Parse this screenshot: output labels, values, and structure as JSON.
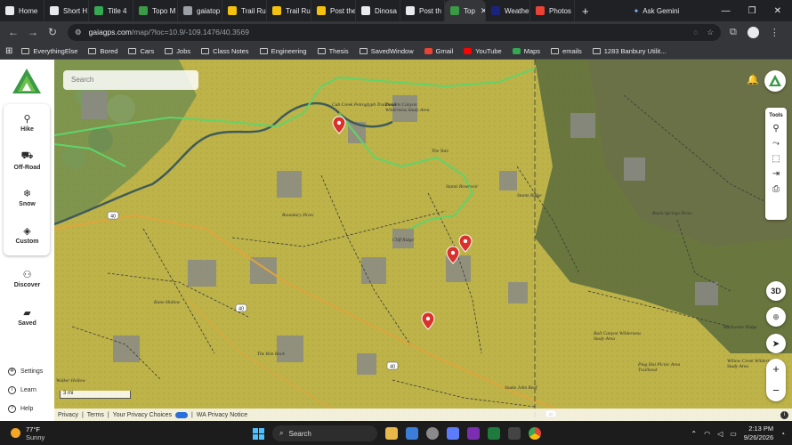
{
  "browser": {
    "tabs": [
      {
        "label": "Home",
        "color": "#e8eaed"
      },
      {
        "label": "Short H",
        "color": "#e8eaed"
      },
      {
        "label": "Title 4",
        "color": "#34a853"
      },
      {
        "label": "Topo M",
        "color": "#3a9a46"
      },
      {
        "label": "gaiatop",
        "color": "#9aa0a6"
      },
      {
        "label": "Trail Ru",
        "color": "#f4c20d"
      },
      {
        "label": "Trail Ru",
        "color": "#f4c20d"
      },
      {
        "label": "Post the",
        "color": "#f4c20d"
      },
      {
        "label": "Dinosa",
        "color": "#e8eaed"
      },
      {
        "label": "Post th",
        "color": "#e8eaed"
      },
      {
        "label": "Top",
        "color": "#3a9a46",
        "active": true
      },
      {
        "label": "Weathe",
        "color": "#1a237e"
      },
      {
        "label": "Photos",
        "color": "#ea4335"
      }
    ],
    "new_tab": "+",
    "ask_gemini": "Ask Gemini",
    "url_host": "gaiagps.com",
    "url_path": "/map/?loc=10.9/-109.1476/40.3569",
    "bookmarks": [
      {
        "label": "EverythingElse",
        "type": "folder"
      },
      {
        "label": "Bored",
        "type": "folder"
      },
      {
        "label": "Cars",
        "type": "folder"
      },
      {
        "label": "Jobs",
        "type": "folder"
      },
      {
        "label": "Class Notes",
        "type": "folder"
      },
      {
        "label": "Engineering",
        "type": "folder"
      },
      {
        "label": "Thesis",
        "type": "folder"
      },
      {
        "label": "SavedWindow",
        "type": "folder"
      },
      {
        "label": "Gmail",
        "type": "gmail"
      },
      {
        "label": "YouTube",
        "type": "youtube"
      },
      {
        "label": "Maps",
        "type": "maps"
      },
      {
        "label": "emails",
        "type": "folder"
      },
      {
        "label": "1283 Banbury Utilit...",
        "type": "folder"
      }
    ]
  },
  "sidebar": {
    "items": [
      {
        "label": "Hike",
        "icon": "hiker-icon"
      },
      {
        "label": "Off-Road",
        "icon": "car-icon"
      },
      {
        "label": "Snow",
        "icon": "snowflake-icon"
      },
      {
        "label": "Custom",
        "icon": "layers-icon"
      }
    ],
    "discover": "Discover",
    "saved": "Saved",
    "settings": "Settings",
    "learn": "Learn",
    "help": "Help"
  },
  "map": {
    "search_placeholder": "Search",
    "tools_label": "Tools",
    "btn_3d": "3D",
    "zoom_in": "+",
    "zoom_out": "−",
    "scale": "3 mi",
    "footer": [
      "Privacy",
      "Terms",
      "Your Privacy Choices",
      "WA Privacy Notice"
    ],
    "labels": [
      {
        "text": "Cub Creek Petroglyph Trailhead"
      },
      {
        "text": "Daniels Canyon Wilderness Study Area"
      },
      {
        "text": "Cliff Ridge"
      },
      {
        "text": "Stuntz Ridge"
      },
      {
        "text": "Basin Springs Draw"
      },
      {
        "text": "Bull Canyon Wilderness Study Area"
      },
      {
        "text": "Plug Hat Picnic Area Trailhead"
      },
      {
        "text": "Buckwater Ridge"
      },
      {
        "text": "Willow Creek Wilderness Study Area"
      },
      {
        "text": "Stuntz Reservoir"
      },
      {
        "text": "The Rim Rock"
      },
      {
        "text": "Kane Hollow"
      },
      {
        "text": "Walker Hollow"
      },
      {
        "text": "Snake John Reef"
      },
      {
        "text": "Boundary Draw"
      },
      {
        "text": "The Yule"
      }
    ],
    "routes": [
      "40",
      "40",
      "40",
      "40"
    ],
    "colors": {
      "blm": "#c6bd4c",
      "route": "#5fd46a",
      "road": "#e0a53c",
      "pin": "#d9312b"
    }
  },
  "taskbar": {
    "temp": "77°F",
    "condition": "Sunny",
    "search": "Search",
    "time": "2:13 PM",
    "date": "9/26/2026"
  }
}
